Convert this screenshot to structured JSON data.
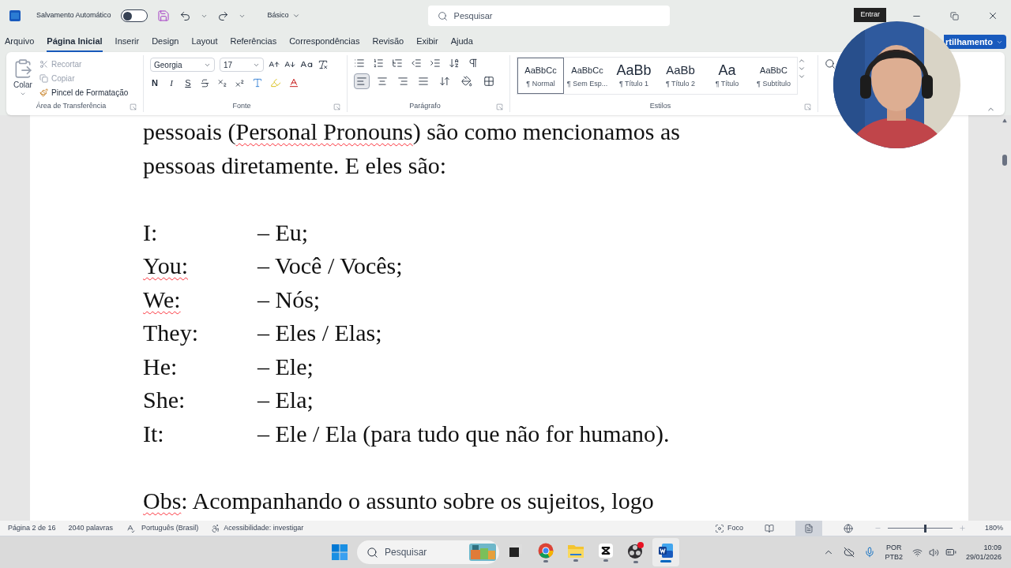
{
  "title_bar": {
    "autosave_label": "Salvamento Automático",
    "autosave_on": false,
    "view_mode": "Básico",
    "search_placeholder": "Pesquisar",
    "sign_in": "Entrar"
  },
  "menu_tabs": [
    {
      "label": "Arquivo",
      "selected": false
    },
    {
      "label": "Página Inicial",
      "selected": true
    },
    {
      "label": "Inserir",
      "selected": false
    },
    {
      "label": "Design",
      "selected": false
    },
    {
      "label": "Layout",
      "selected": false
    },
    {
      "label": "Referências",
      "selected": false
    },
    {
      "label": "Correspondências",
      "selected": false
    },
    {
      "label": "Revisão",
      "selected": false
    },
    {
      "label": "Exibir",
      "selected": false
    },
    {
      "label": "Ajuda",
      "selected": false
    }
  ],
  "share_button": "rtilhamento",
  "ribbon": {
    "clipboard": {
      "group": "Área de Transferência",
      "paste": "Colar",
      "actions": [
        {
          "label": "Recortar",
          "disabled": true
        },
        {
          "label": "Copiar",
          "disabled": true
        },
        {
          "label": "Pincel de Formatação",
          "disabled": false
        }
      ]
    },
    "font": {
      "group": "Fonte",
      "name": "Georgia",
      "size": "17",
      "bold": "N",
      "italic": "I",
      "underline": "S"
    },
    "paragraph": {
      "group": "Parágrafo",
      "alignments": [
        {
          "kind": "left",
          "selected": true
        },
        {
          "kind": "center",
          "selected": false
        },
        {
          "kind": "right",
          "selected": false
        },
        {
          "kind": "justify",
          "selected": false
        }
      ]
    },
    "styles": {
      "group": "Estilos",
      "items": [
        {
          "preview": "AaBbCc",
          "name": "¶ Normal",
          "selected": true
        },
        {
          "preview": "AaBbCc",
          "name": "¶ Sem Esp...",
          "selected": false
        },
        {
          "preview": "AaBb",
          "name": "¶ Título 1",
          "selected": false
        },
        {
          "preview": "AaBb",
          "name": "¶ Título 2",
          "selected": false
        },
        {
          "preview": "Aa",
          "name": "¶ Título",
          "selected": false
        },
        {
          "preview": "AaBbC",
          "name": "¶ Subtítulo",
          "selected": false
        }
      ]
    }
  },
  "document": {
    "intro": [
      [
        {
          "text": "pessoais (",
          "misspelled": false
        },
        {
          "text": "Personal",
          "misspelled": true
        },
        {
          "text": " Pronouns",
          "misspelled": true
        },
        {
          "text": ") são como mencionamos as",
          "misspelled": false
        }
      ],
      [
        {
          "text": "pessoas diretamente. E eles são:",
          "misspelled": false
        }
      ]
    ],
    "pronouns": [
      {
        "term": "I:",
        "misspelled": false,
        "meaning": "– Eu;"
      },
      {
        "term": "You:",
        "misspelled": true,
        "meaning": "– Você / Vocês;"
      },
      {
        "term": "We:",
        "misspelled": true,
        "meaning": "– Nós;"
      },
      {
        "term": "They:",
        "misspelled": false,
        "meaning": "– Eles / Elas;"
      },
      {
        "term": "He:",
        "misspelled": false,
        "meaning": "– Ele;"
      },
      {
        "term": "She:",
        "misspelled": false,
        "meaning": "– Ela;"
      },
      {
        "term": "It:",
        "misspelled": false,
        "meaning": "– Ele / Ela (para tudo que não for humano)."
      }
    ],
    "note": [
      {
        "text": "Obs",
        "misspelled": true
      },
      {
        "text": ": Acompanhando o assunto sobre os sujeitos, logo",
        "misspelled": false
      }
    ]
  },
  "status_bar": {
    "page": "Página 2 de 16",
    "words": "2040 palavras",
    "language": "Português (Brasil)",
    "accessibility": "Acessibilidade: investigar",
    "focus": "Foco",
    "views": [
      {
        "kind": "read",
        "selected": false
      },
      {
        "kind": "print",
        "selected": true
      },
      {
        "kind": "web",
        "selected": false
      }
    ],
    "zoom": {
      "level": 0.56,
      "reading": "180%"
    }
  },
  "taskbar": {
    "search_placeholder": "Pesquisar",
    "apps": [
      {
        "kind": "task-view",
        "running": false,
        "active": false
      },
      {
        "kind": "chrome",
        "running": true,
        "active": false
      },
      {
        "kind": "explorer",
        "running": true,
        "active": false
      },
      {
        "kind": "capcut",
        "running": true,
        "active": false
      },
      {
        "kind": "obs",
        "running": true,
        "active": false
      },
      {
        "kind": "word",
        "running": true,
        "active": true
      }
    ],
    "language": "POR",
    "layout": "PTB2",
    "time": "10:09",
    "date": "29/01/2026"
  }
}
